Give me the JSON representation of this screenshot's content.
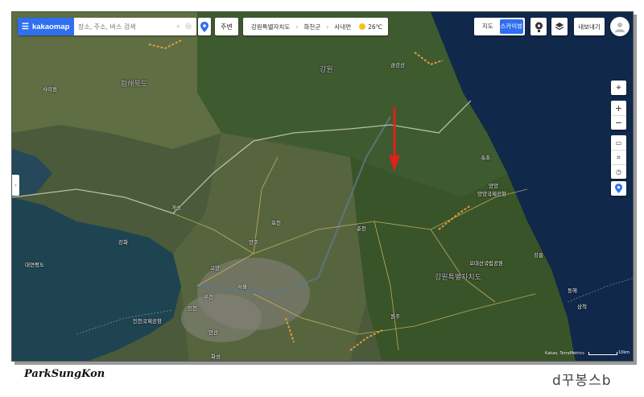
{
  "search": {
    "menu_icon": "hamburger-icon",
    "logo": "kakaomap",
    "placeholder": "장소, 주소, 버스 검색"
  },
  "nearby_label": "주변",
  "breadcrumb": {
    "province": "강원특별자치도",
    "county": "화천군",
    "town": "사내면",
    "temperature": "26℃"
  },
  "map_type": {
    "map": "지도",
    "sky": "스카이뷰",
    "active": "sky"
  },
  "export_label": "내보내기",
  "right_tools": [
    "location-target-icon",
    "zoom-in-icon",
    "zoom-out-icon",
    "ruler-icon",
    "area-icon",
    "radius-icon",
    "pin-icon"
  ],
  "map_labels": [
    {
      "text": "금강산"
    },
    {
      "text": "강원"
    },
    {
      "text": "황해북도"
    },
    {
      "text": "사리원"
    },
    {
      "text": "개성"
    },
    {
      "text": "포천"
    },
    {
      "text": "춘천"
    },
    {
      "text": "양주"
    },
    {
      "text": "고양"
    },
    {
      "text": "서울"
    },
    {
      "text": "부천"
    },
    {
      "text": "인천"
    },
    {
      "text": "안산"
    },
    {
      "text": "화성"
    },
    {
      "text": "속초"
    },
    {
      "text": "양양"
    },
    {
      "text": "강릉"
    },
    {
      "text": "원주"
    },
    {
      "text": "삼척"
    },
    {
      "text": "동해"
    },
    {
      "text": "대연평도"
    },
    {
      "text": "강화"
    },
    {
      "text": "인천국제공항"
    },
    {
      "text": "강원특별자치도"
    },
    {
      "text": "오대산국립공원"
    },
    {
      "text": "양양국제공항"
    }
  ],
  "copyright": "Kakao, TerraMetrics",
  "scale_label": "10km",
  "signature_left": "ParkSungKon",
  "signature_right": "d꾸봉스b"
}
